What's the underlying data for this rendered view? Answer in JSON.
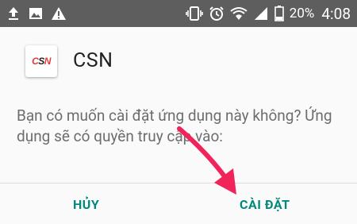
{
  "status_bar": {
    "left_icons": [
      "upload-icon",
      "image-icon",
      "warning-icon"
    ],
    "right_icons": [
      "vibrate-icon",
      "alarm-icon",
      "wifi-icon",
      "signal-icon",
      "battery-icon"
    ],
    "battery": "20%",
    "time": "4:08"
  },
  "app": {
    "name": "CSN",
    "icon_text": "CSN",
    "icon_colors": {
      "c": "#e53935",
      "s": "#212121",
      "n": "#e53935"
    }
  },
  "dialog": {
    "message": "Bạn có muốn cài đặt ứng dụng này không? Ứng dụng sẽ có quyền truy cập vào:",
    "cancel_label": "HỦY",
    "install_label": "CÀI ĐẶT"
  },
  "annotation": {
    "arrow_color": "#f0235a"
  }
}
